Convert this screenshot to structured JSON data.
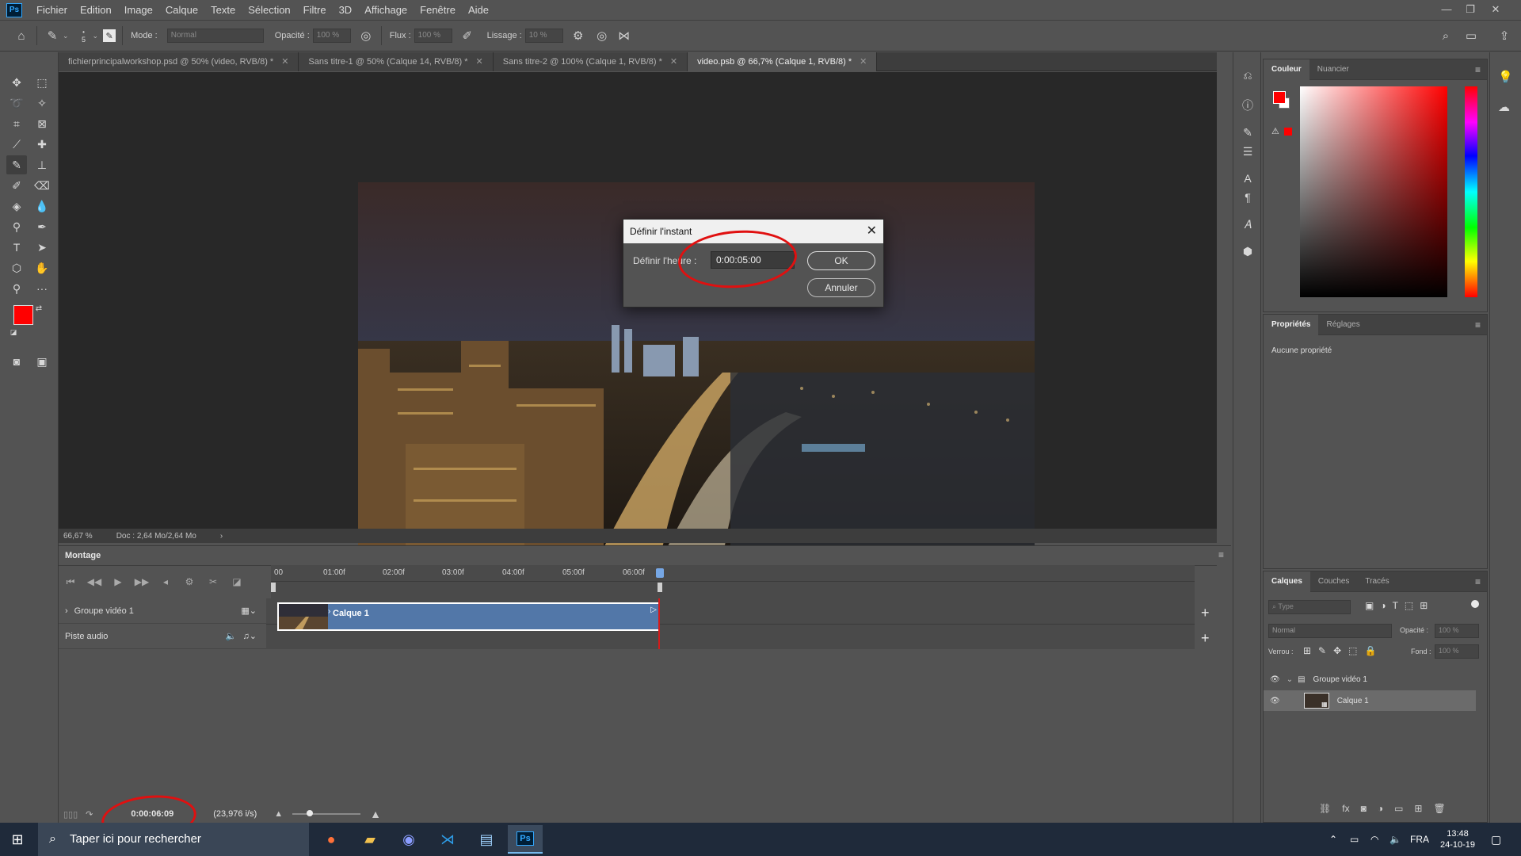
{
  "app": {
    "logo": "Ps",
    "menu": [
      "Fichier",
      "Edition",
      "Image",
      "Calque",
      "Texte",
      "Sélection",
      "Filtre",
      "3D",
      "Affichage",
      "Fenêtre",
      "Aide"
    ]
  },
  "options_bar": {
    "brush_size": "5",
    "mode_label": "Mode :",
    "mode_value": "Normal",
    "opacity_label": "Opacité :",
    "opacity_value": "100 %",
    "flow_label": "Flux :",
    "flow_value": "100 %",
    "smoothing_label": "Lissage :",
    "smoothing_value": "10 %"
  },
  "doc_tabs": [
    {
      "label": "fichierprincipalworkshop.psd @ 50% (video, RVB/8) *",
      "active": false
    },
    {
      "label": "Sans titre-1 @ 50% (Calque 14, RVB/8) *",
      "active": false
    },
    {
      "label": "Sans titre-2 @ 100% (Calque 1, RVB/8) *",
      "active": false
    },
    {
      "label": "video.psb @ 66,7% (Calque 1, RVB/8) *",
      "active": true
    }
  ],
  "status_bar": {
    "zoom": "66,67 %",
    "doc_info": "Doc : 2,64 Mo/2,64 Mo"
  },
  "dialog": {
    "title": "Définir l'instant",
    "field_label": "Définir l'heure :",
    "field_value": "0:00:05:00",
    "ok_label": "OK",
    "cancel_label": "Annuler"
  },
  "timeline": {
    "panel_title": "Montage",
    "ruler_ticks": [
      "00",
      "01:00f",
      "02:00f",
      "03:00f",
      "04:00f",
      "05:00f",
      "06:00f"
    ],
    "tracks": [
      {
        "label": "Groupe vidéo 1"
      },
      {
        "label": "Piste audio"
      }
    ],
    "clip_label": "Calque 1",
    "current_time": "0:00:06:09",
    "frame_rate": "(23,976 i/s)"
  },
  "color_panel": {
    "tabs": [
      "Couleur",
      "Nuancier"
    ],
    "foreground": "#ff0000",
    "background": "#ffffff"
  },
  "properties_panel": {
    "tabs": [
      "Propriétés",
      "Réglages"
    ],
    "empty_text": "Aucune propriété"
  },
  "layers_panel": {
    "tabs": [
      "Calques",
      "Couches",
      "Tracés"
    ],
    "search_placeholder": "Type",
    "blend_mode": "Normal",
    "opacity_label": "Opacité :",
    "opacity_value": "100 %",
    "lock_label": "Verrou :",
    "fill_label": "Fond :",
    "fill_value": "100 %",
    "layers": [
      {
        "name": "Groupe vidéo 1",
        "type": "group"
      },
      {
        "name": "Calque 1",
        "type": "video",
        "selected": true
      }
    ]
  },
  "taskbar": {
    "search_placeholder": "Taper ici pour rechercher",
    "language": "FRA",
    "time": "13:48",
    "date": "24-10-19"
  }
}
